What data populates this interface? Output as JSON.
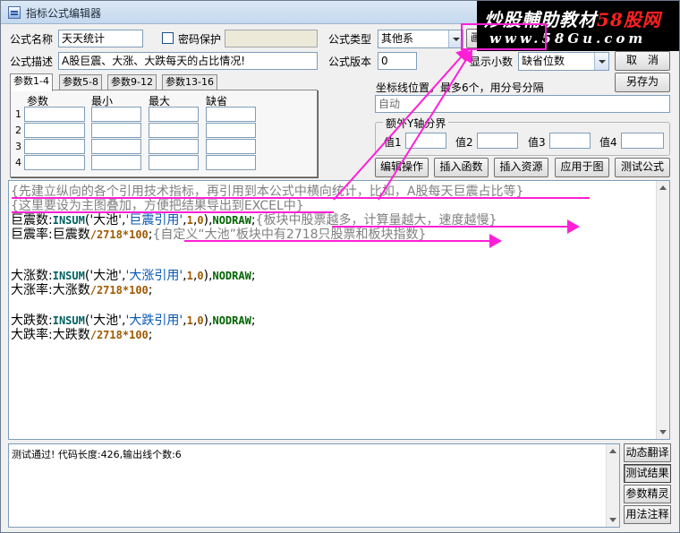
{
  "window": {
    "title": "指标公式编辑器"
  },
  "form": {
    "name_label": "公式名称",
    "name_value": "天天统计",
    "password_label": "密码保护",
    "type_label": "公式类型",
    "type_value": "其他系",
    "draw_label": "画",
    "desc_label": "公式描述",
    "desc_value": "A股巨震、大涨、大跌每天的占比情况!",
    "version_label": "公式版本",
    "version_value": "0",
    "decimal_label": "显示小数",
    "decimal_value": "缺省位数",
    "cancel_label": "取　消",
    "save_as_label": "另存为"
  },
  "tabs": [
    "参数1-4",
    "参数5-8",
    "参数9-12",
    "参数13-16"
  ],
  "params": {
    "headers": [
      "参数",
      "最小",
      "最大",
      "缺省"
    ],
    "rows": [
      "1",
      "2",
      "3",
      "4"
    ]
  },
  "coord": {
    "label": "坐标线位置，最多6个，用分号分隔",
    "value": "自动"
  },
  "yaxis": {
    "title": "额外Y轴分界",
    "labels": [
      "值1",
      "值2",
      "值3",
      "值4"
    ]
  },
  "buttons": [
    "编辑操作",
    "插入函数",
    "插入资源",
    "应用于图",
    "测试公式"
  ],
  "code": {
    "c1": "{先建立纵向的各个引用技术指标，再引用到本公式中横向统计，比如，A股每天巨震占比等}",
    "c2": "{这里要设为主图叠加，方便把结果导出到EXCEL中}",
    "l3": {
      "var": "巨震数",
      "colon": ":",
      "fn": "INSUM",
      "p_open": "(",
      "s1": "'大池'",
      "comma1": ",",
      "s2": "'巨震引用'",
      "comma2": ",",
      "n1": "1",
      "comma3": ",",
      "n2": "0",
      "p_close": "),",
      "nd": "NODRAW",
      "semi": ";",
      "cm": "{板块中股票越多，计算量越大，速度越慢}"
    },
    "l4": {
      "var": "巨震率",
      "colon": ":",
      "ref": "巨震数",
      "div": "/",
      "n1": "2718",
      "mul": "*",
      "n2": "100",
      "semi": ";",
      "cm": "{自定义“大池”板块中有2718只股票和板块指数}"
    },
    "l6": {
      "var": "大涨数",
      "colon": ":",
      "fn": "INSUM",
      "p_open": "(",
      "s1": "'大池'",
      "comma1": ",",
      "s2": "'大涨引用'",
      "comma2": ",",
      "n1": "1",
      "comma3": ",",
      "n2": "0",
      "p_close": "),",
      "nd": "NODRAW",
      "semi": ";"
    },
    "l7": {
      "var": "大涨率",
      "colon": ":",
      "ref": "大涨数",
      "div": "/",
      "n1": "2718",
      "mul": "*",
      "n2": "100",
      "semi": ";"
    },
    "l9": {
      "var": "大跌数",
      "colon": ":",
      "fn": "INSUM",
      "p_open": "(",
      "s1": "'大池'",
      "comma1": ",",
      "s2": "'大跌引用'",
      "comma2": ",",
      "n1": "1",
      "comma3": ",",
      "n2": "0",
      "p_close": "),",
      "nd": "NODRAW",
      "semi": ";"
    },
    "l10": {
      "var": "大跌率",
      "colon": ":",
      "ref": "大跌数",
      "div": "/",
      "n1": "2718",
      "mul": "*",
      "n2": "100",
      "semi": ";"
    }
  },
  "output": {
    "text": "测试通过! 代码长度:426,输出线个数:6"
  },
  "side_buttons": [
    "动态翻译",
    "测试结果",
    "参数精灵",
    "用法注释"
  ],
  "watermark": {
    "line1": "炒股輔助教材",
    "line1_accent": "58股网",
    "line2": "www.58Gu.com"
  },
  "colors": {
    "annotation": "#ff1fd6",
    "keyword": "#006060",
    "string": "#0a57b3",
    "number": "#a05a00",
    "nodraw": "#006400"
  }
}
